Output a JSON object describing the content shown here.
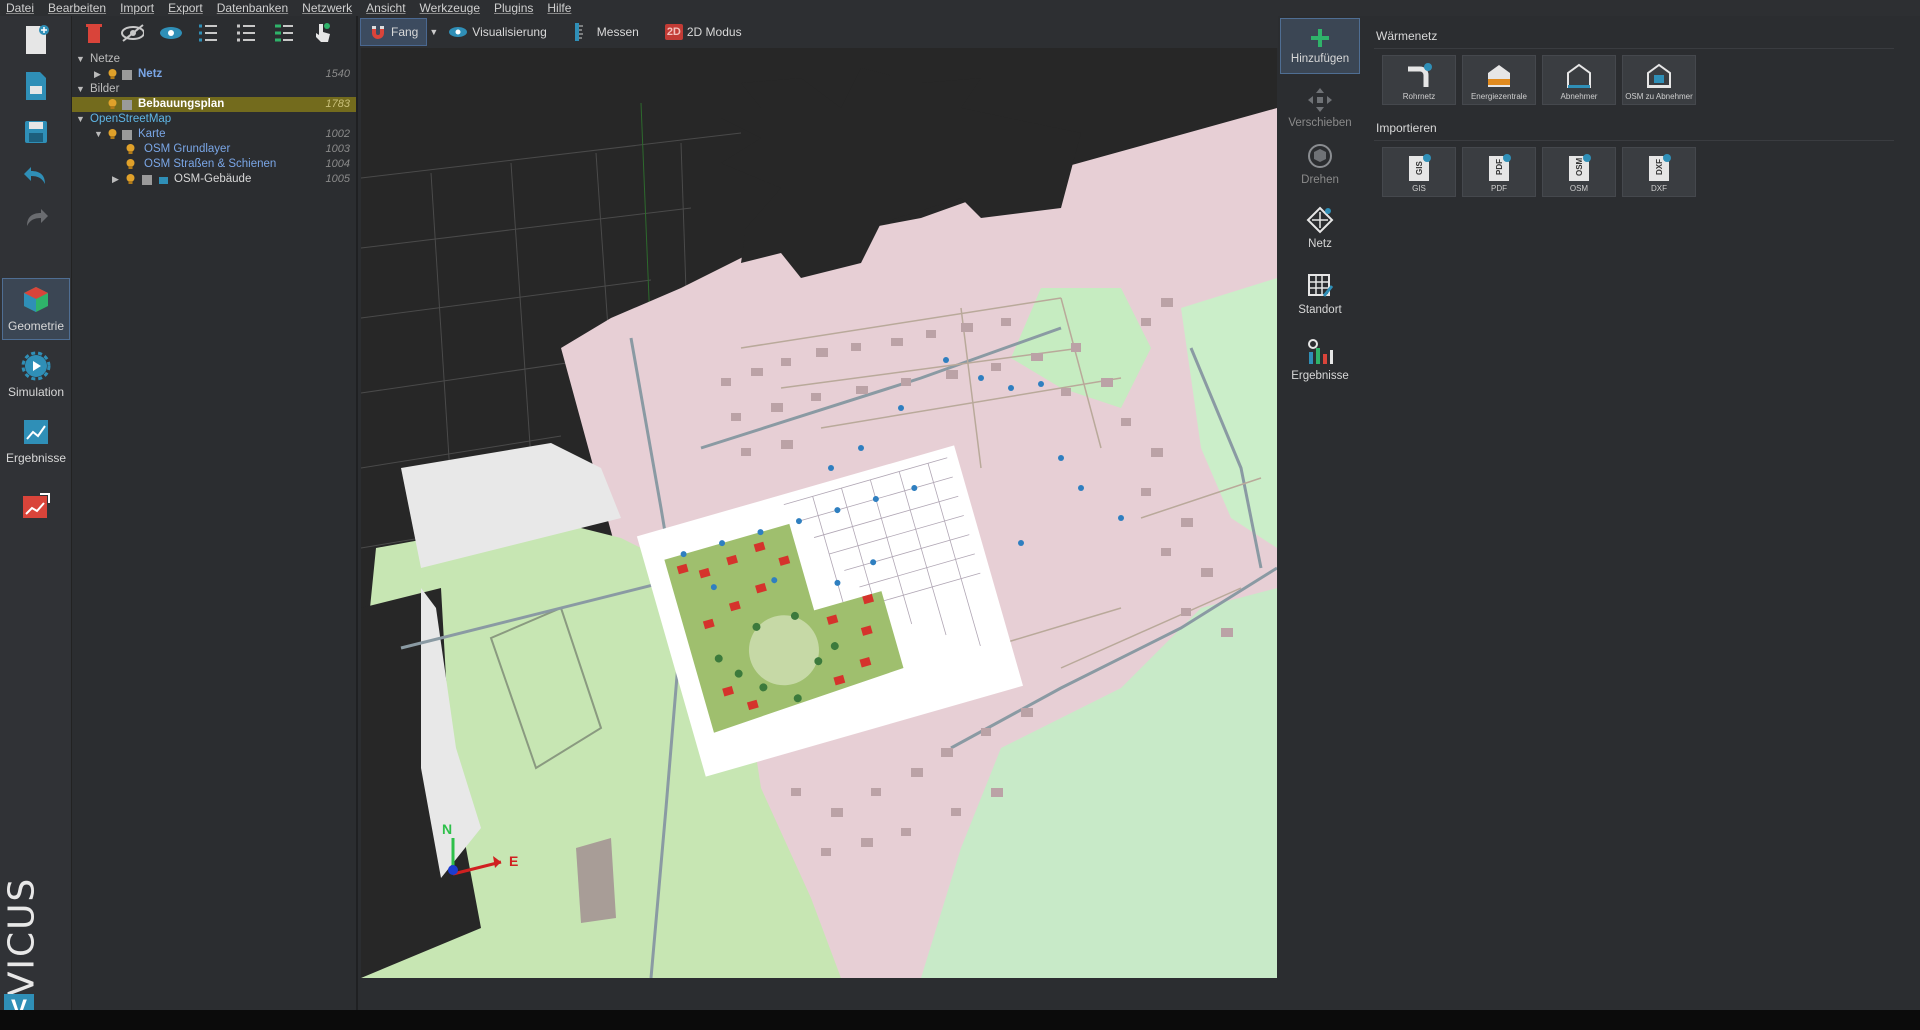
{
  "menu": [
    "Datei",
    "Bearbeiten",
    "Import",
    "Export",
    "Datenbanken",
    "Netzwerk",
    "Ansicht",
    "Werkzeuge",
    "Plugins",
    "Hilfe"
  ],
  "modes": {
    "geometrie": "Geometrie",
    "simulation": "Simulation",
    "ergebnisse": "Ergebnisse"
  },
  "tree": {
    "netze": {
      "label": "Netze"
    },
    "netz": {
      "label": "Netz",
      "id": "1540"
    },
    "bilder": {
      "label": "Bilder"
    },
    "bebauungsplan": {
      "label": "Bebauungsplan",
      "id": "1783"
    },
    "osm": {
      "label": "OpenStreetMap"
    },
    "karte": {
      "label": "Karte",
      "id": "1002"
    },
    "grundlayer": {
      "label": "OSM Grundlayer",
      "id": "1003"
    },
    "strassen": {
      "label": "OSM Straßen & Schienen",
      "id": "1004"
    },
    "gebaeude": {
      "label": "OSM-Gebäude",
      "id": "1005"
    }
  },
  "viewtoolbar": {
    "fang": "Fang",
    "visualisierung": "Visualisierung",
    "messen": "Messen",
    "modus_badge": "2D",
    "modus": "2D Modus"
  },
  "tools": {
    "hinzufuegen": "Hinzufügen",
    "verschieben": "Verschieben",
    "drehen": "Drehen",
    "netz": "Netz",
    "standort": "Standort",
    "ergebnisse": "Ergebnisse"
  },
  "panel": {
    "waermenetz": "Wärmenetz",
    "tiles1": [
      "Rohrnetz",
      "Energiezentrale",
      "Abnehmer",
      "OSM zu Abnehmer"
    ],
    "importieren": "Importieren",
    "tiles2": [
      "GIS",
      "PDF",
      "OSM",
      "DXF"
    ]
  },
  "axes": {
    "n": "N",
    "e": "E"
  },
  "brand": "VICUS",
  "colors": {
    "accent": "#2f8fb7",
    "selection": "#736b1d",
    "add": "#2fb36a",
    "delete": "#d9443a"
  }
}
